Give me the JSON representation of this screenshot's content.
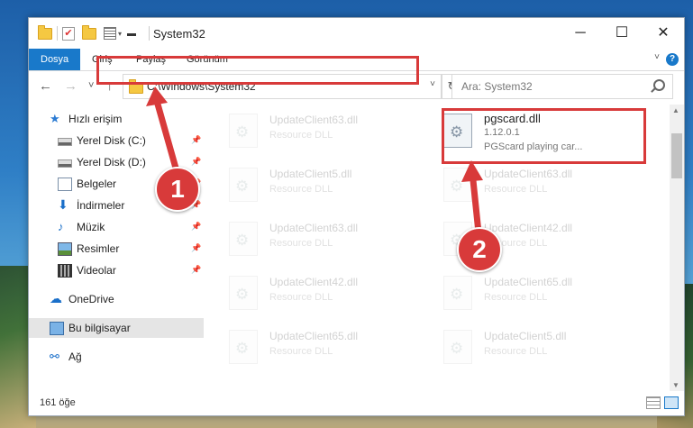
{
  "window": {
    "title": "System32",
    "controls": {
      "minimize": "─",
      "maximize": "☐",
      "close": "✕"
    }
  },
  "ribbon": {
    "tabs": [
      {
        "label": "Dosya",
        "active": true
      },
      {
        "label": "Giriş"
      },
      {
        "label": "Paylaş"
      },
      {
        "label": "Görünüm"
      }
    ],
    "help": "?"
  },
  "nav": {
    "back": "←",
    "forward": "→",
    "recent": "˅",
    "up": "↑",
    "address": "C:\\Windows\\System32",
    "refresh": "↻",
    "search_placeholder": "Ara: System32"
  },
  "sidebar": {
    "items": [
      {
        "label": "Hızlı erişim",
        "icon": "star-icon"
      },
      {
        "label": "Yerel Disk (C:)",
        "icon": "disk-icon",
        "pinned": true
      },
      {
        "label": "Yerel Disk (D:)",
        "icon": "disk-icon",
        "pinned": true
      },
      {
        "label": "Belgeler",
        "icon": "documents-icon",
        "pinned": true
      },
      {
        "label": "İndirmeler",
        "icon": "downloads-icon",
        "pinned": true
      },
      {
        "label": "Müzik",
        "icon": "music-icon",
        "pinned": true
      },
      {
        "label": "Resimler",
        "icon": "pictures-icon",
        "pinned": true
      },
      {
        "label": "Videolar",
        "icon": "videos-icon",
        "pinned": true
      },
      {
        "label": "OneDrive",
        "icon": "onedrive-icon"
      },
      {
        "label": "Bu bilgisayar",
        "icon": "this-pc-icon",
        "selected": true
      },
      {
        "label": "Ağ",
        "icon": "network-icon"
      }
    ]
  },
  "files": {
    "left": [
      {
        "name": "UpdateClient63.dll",
        "type": "Resource DLL"
      },
      {
        "name": "UpdateClient5.dll",
        "type": "Resource DLL"
      },
      {
        "name": "UpdateClient63.dll",
        "type": "Resource DLL"
      },
      {
        "name": "UpdateClient42.dll",
        "type": "Resource DLL"
      },
      {
        "name": "UpdateClient65.dll",
        "type": "Resource DLL"
      }
    ],
    "right": [
      {
        "name": "UpdateClient63.dll",
        "type": "Resource DLL"
      },
      {
        "name": "UpdateClient42.dll",
        "type": "Resource DLL"
      },
      {
        "name": "UpdateClient65.dll",
        "type": "Resource DLL"
      },
      {
        "name": "UpdateClient5.dll",
        "type": "Resource DLL"
      }
    ],
    "target": {
      "name": "pgscard.dll",
      "version": "1.12.0.1",
      "description": "PGScard playing car..."
    }
  },
  "status": {
    "item_count": "161 öğe"
  },
  "markers": [
    "1",
    "2"
  ],
  "colors": {
    "accent": "#1979ca",
    "highlight": "#d83a3a"
  }
}
